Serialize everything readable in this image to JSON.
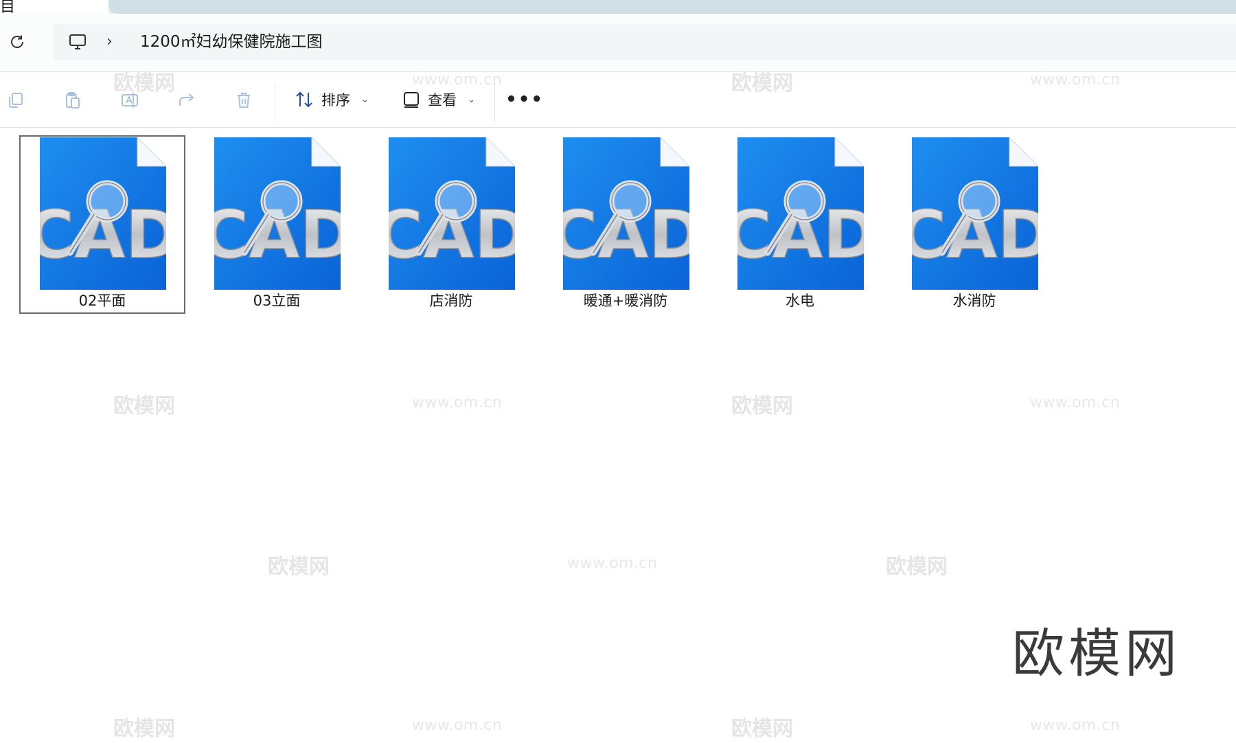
{
  "tab": {
    "fragment": "目"
  },
  "address_bar": {
    "path_segments": [
      "1200㎡妇幼保健院施工图"
    ]
  },
  "toolbar": {
    "sort_label": "排序",
    "view_label": "查看",
    "more_label": "•••"
  },
  "files": [
    {
      "name": "02平面",
      "selected": true
    },
    {
      "name": "03立面",
      "selected": false
    },
    {
      "name": "店消防",
      "selected": false
    },
    {
      "name": "暖通+暖消防",
      "selected": false
    },
    {
      "name": "水电",
      "selected": false
    },
    {
      "name": "水消防",
      "selected": false
    }
  ],
  "file_icon_text": "CAD",
  "watermarks": {
    "logo_text": "欧模网",
    "url_text": "www.om.cn",
    "brand_text": "欧模网"
  },
  "colors": {
    "cad_blue": "#0a63d6",
    "cad_blue_light": "#1e8ef0",
    "selection_border": "#6b6b6b"
  }
}
